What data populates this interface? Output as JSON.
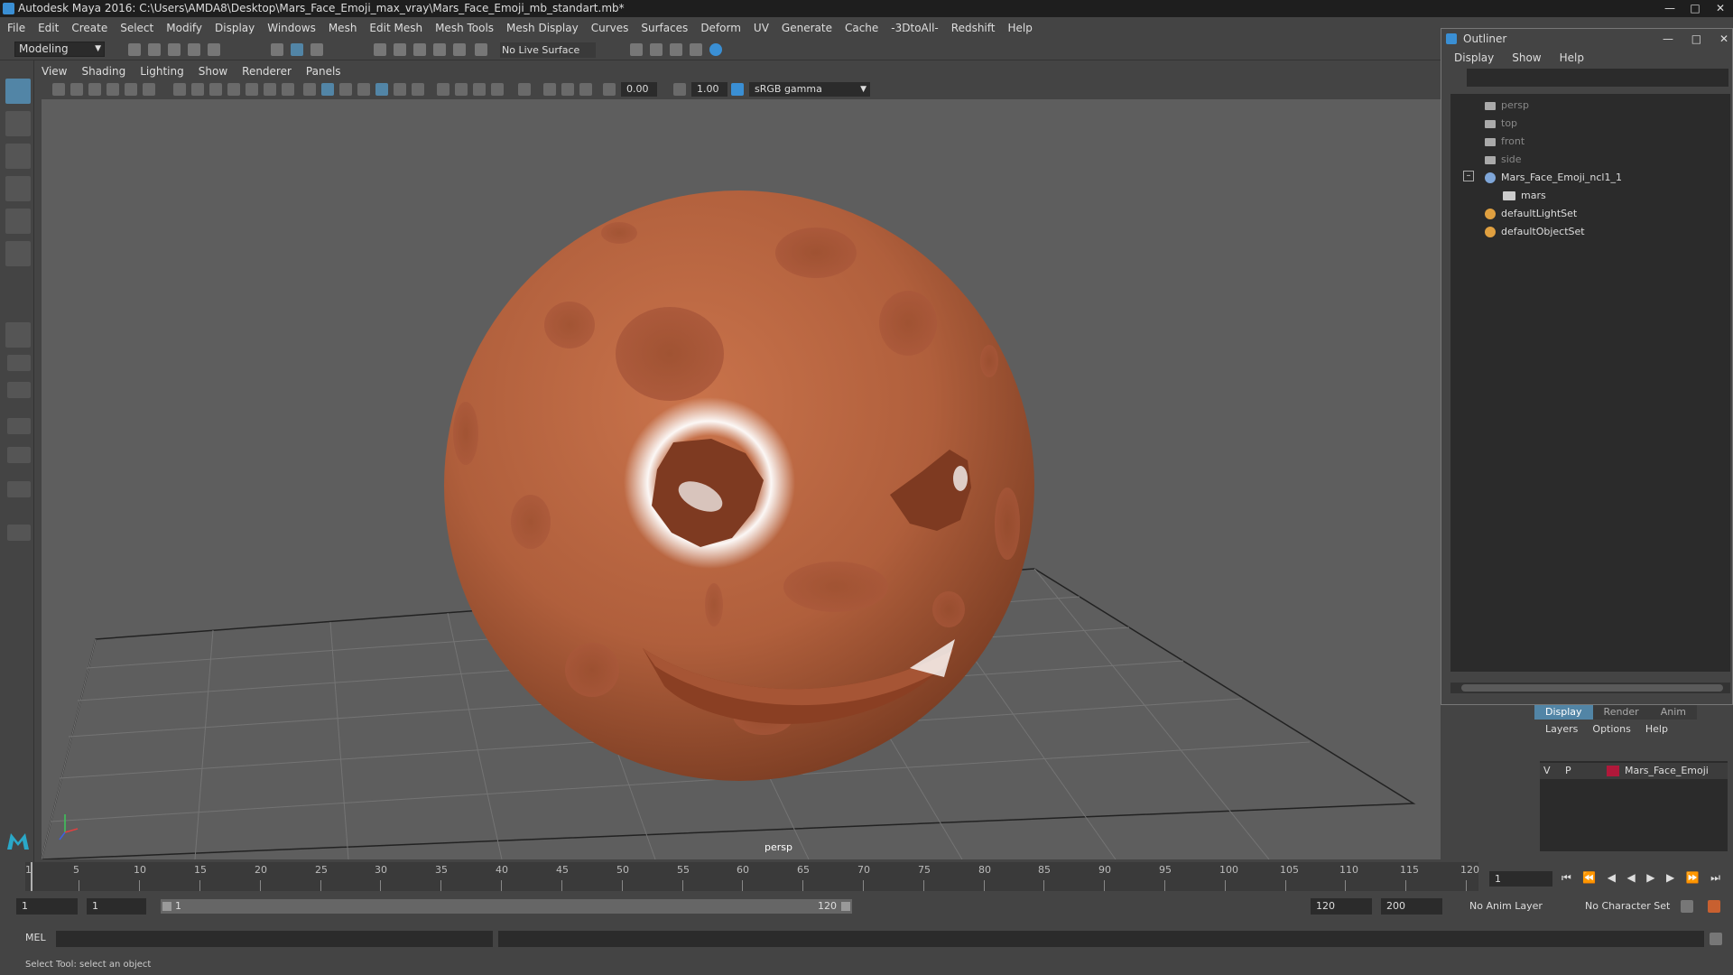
{
  "window": {
    "title": "Autodesk Maya 2016: C:\\Users\\AMDA8\\Desktop\\Mars_Face_Emoji_max_vray\\Mars_Face_Emoji_mb_standart.mb*"
  },
  "menubar": {
    "items": [
      "File",
      "Edit",
      "Create",
      "Select",
      "Modify",
      "Display",
      "Windows",
      "Mesh",
      "Edit Mesh",
      "Mesh Tools",
      "Mesh Display",
      "Curves",
      "Surfaces",
      "Deform",
      "UV",
      "Generate",
      "Cache",
      "-3DtoAll-",
      "Redshift",
      "Help"
    ]
  },
  "shelf": {
    "mode": "Modeling",
    "live_surface": "No Live Surface"
  },
  "panel": {
    "menu": [
      "View",
      "Shading",
      "Lighting",
      "Show",
      "Renderer",
      "Panels"
    ],
    "exposure": "0.00",
    "gamma": "1.00",
    "colorspace": "sRGB gamma",
    "camera": "persp"
  },
  "outliner": {
    "title": "Outliner",
    "menu": [
      "Display",
      "Show",
      "Help"
    ],
    "items": [
      {
        "label": "persp"
      },
      {
        "label": "top"
      },
      {
        "label": "front"
      },
      {
        "label": "side"
      },
      {
        "label": "Mars_Face_Emoji_ncl1_1"
      },
      {
        "label": "mars"
      },
      {
        "label": "defaultLightSet"
      },
      {
        "label": "defaultObjectSet"
      }
    ]
  },
  "layers": {
    "tabs": [
      "Display",
      "Render",
      "Anim"
    ],
    "menu": [
      "Layers",
      "Options",
      "Help"
    ],
    "row": {
      "v": "V",
      "p": "P",
      "name": "Mars_Face_Emoji",
      "color": "#b0183a"
    }
  },
  "timeline": {
    "ticks": [
      "1",
      "5",
      "10",
      "15",
      "20",
      "25",
      "30",
      "35",
      "40",
      "45",
      "50",
      "55",
      "60",
      "65",
      "70",
      "75",
      "80",
      "85",
      "90",
      "95",
      "100",
      "105",
      "110",
      "115",
      "120"
    ],
    "current_frame": "1"
  },
  "range": {
    "start": "1",
    "inner_start": "1",
    "slider_start": "1",
    "slider_end": "120",
    "end": "120",
    "total_end": "200",
    "anim_layer": "No Anim Layer",
    "char_set": "No Character Set"
  },
  "command": {
    "label": "MEL"
  },
  "help": {
    "text": "Select Tool: select an object"
  },
  "colors": {
    "planet": "#b5633f",
    "viewport_bg": "#5e5e5e",
    "accent": "#5285a6"
  }
}
